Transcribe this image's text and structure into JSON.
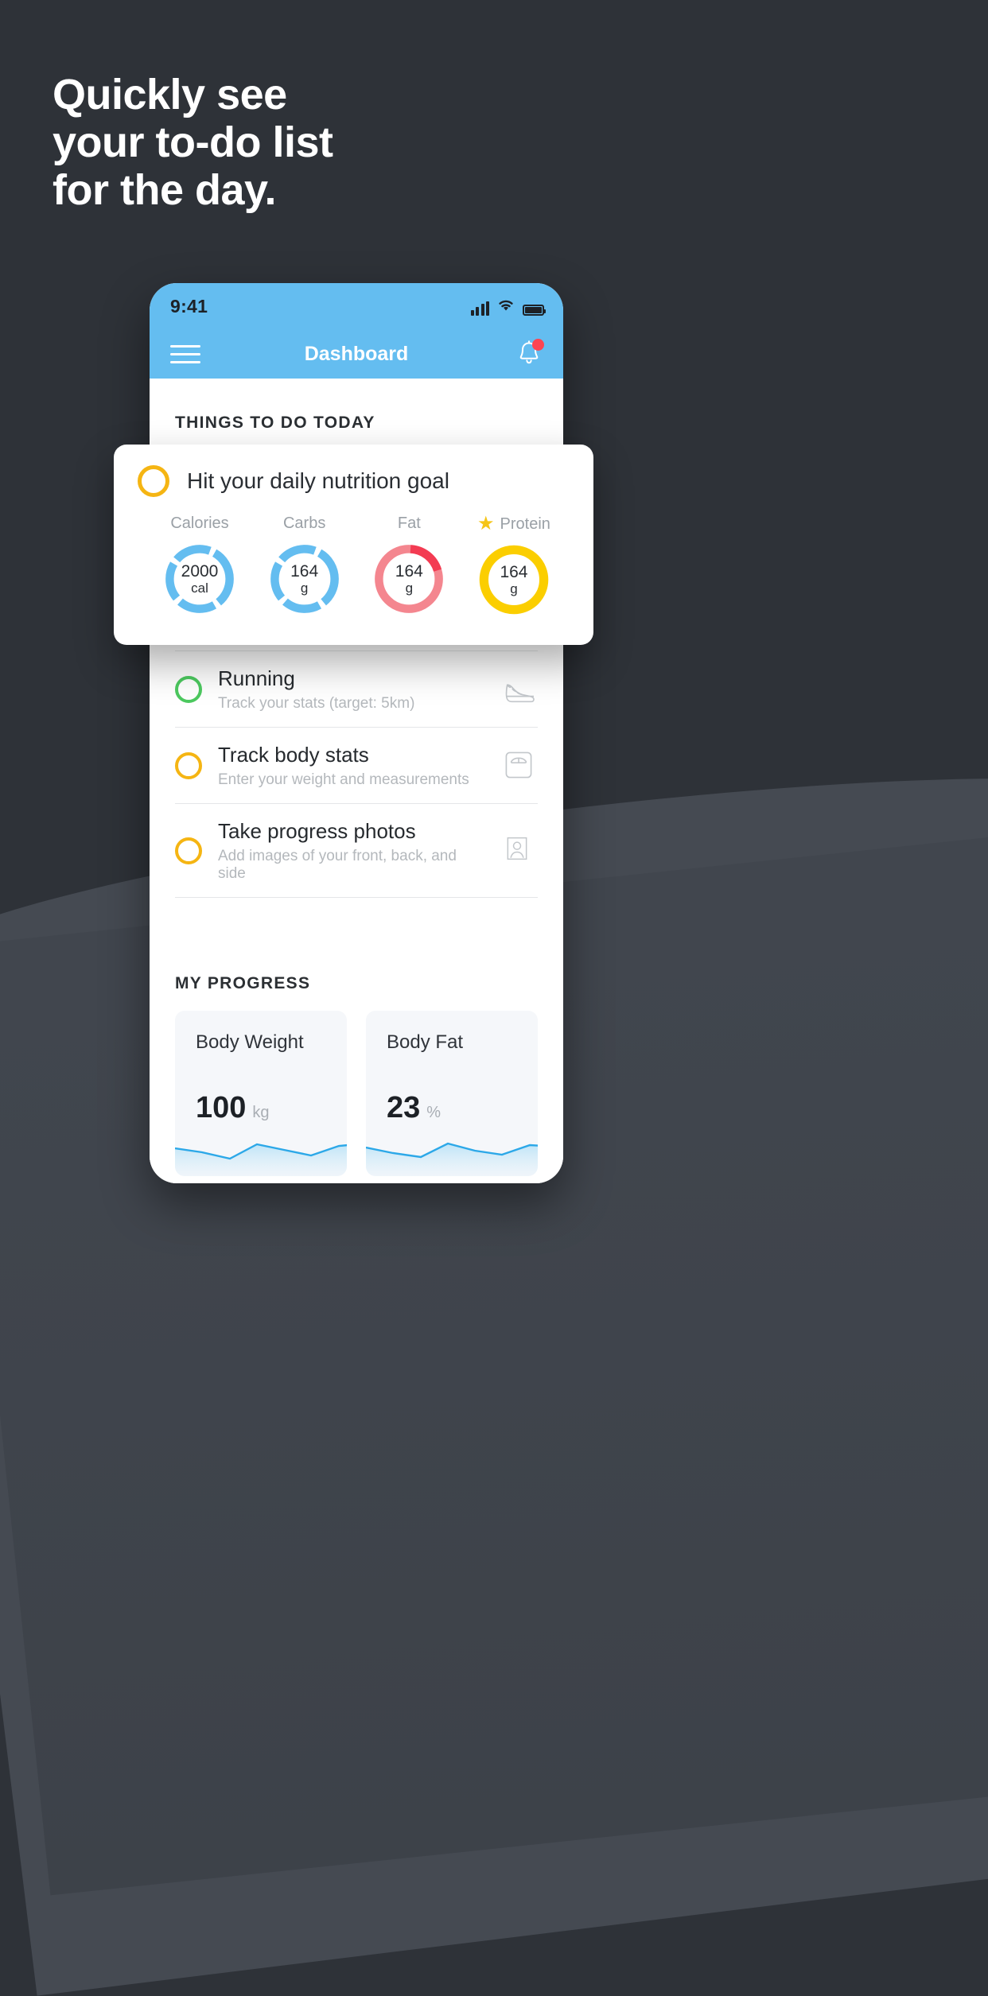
{
  "headline": {
    "lines": [
      "Quickly see",
      "your to-do list",
      "for the day."
    ]
  },
  "phone": {
    "status_bar": {
      "time": "9:41",
      "signal_icon": "signal-bars-icon",
      "wifi_icon": "wifi-icon",
      "battery_icon": "battery-icon"
    },
    "nav": {
      "menu_icon": "hamburger-menu-icon",
      "title": "Dashboard",
      "bell_icon": "bell-icon",
      "badge_color": "#fc4552"
    },
    "sections": {
      "todo_title": "THINGS TO DO TODAY",
      "progress_title": "MY PROGRESS"
    },
    "tasks": [
      {
        "title": "Running",
        "subtitle": "Track your stats (target: 5km)",
        "ring_color": "#4cc95f",
        "icon": "running-shoe-icon"
      },
      {
        "title": "Track body stats",
        "subtitle": "Enter your weight and measurements",
        "ring_color": "#f5b513",
        "icon": "weight-scale-icon"
      },
      {
        "title": "Take progress photos",
        "subtitle": "Add images of your front, back, and side",
        "ring_color": "#f5b513",
        "icon": "person-photo-icon"
      }
    ],
    "progress_cards": [
      {
        "label": "Body Weight",
        "value": "100",
        "unit": "kg"
      },
      {
        "label": "Body Fat",
        "value": "23",
        "unit": "%"
      }
    ]
  },
  "nutrition_card": {
    "ring_color": "#f5b513",
    "title": "Hit your daily nutrition goal",
    "macros": [
      {
        "label": "Calories",
        "value": "2000",
        "unit": "cal",
        "color": "#64bdf0",
        "starred": false
      },
      {
        "label": "Carbs",
        "value": "164",
        "unit": "g",
        "color": "#64bdf0",
        "starred": false
      },
      {
        "label": "Fat",
        "value": "164",
        "unit": "g",
        "color": "#f4868f",
        "starred": false
      },
      {
        "label": "Protein",
        "value": "164",
        "unit": "g",
        "color": "#fbce00",
        "starred": true
      }
    ],
    "star_icon": "star-icon"
  },
  "chart_data": [
    {
      "type": "area",
      "title": "Body Weight",
      "ylabel": "kg",
      "x": [
        0,
        1,
        2,
        3,
        4,
        5,
        6,
        7
      ],
      "values": [
        62,
        55,
        40,
        72,
        63,
        50,
        70,
        76
      ],
      "line_color": "#2ca8e8",
      "fill": "light-blue-gradient",
      "grid": false,
      "legend": "none"
    },
    {
      "type": "area",
      "title": "Body Fat",
      "ylabel": "%",
      "x": [
        0,
        1,
        2,
        3,
        4,
        5,
        6,
        7
      ],
      "values": [
        64,
        54,
        42,
        74,
        62,
        52,
        72,
        70
      ],
      "line_color": "#2ca8e8",
      "fill": "light-blue-gradient",
      "grid": false,
      "legend": "none"
    }
  ]
}
